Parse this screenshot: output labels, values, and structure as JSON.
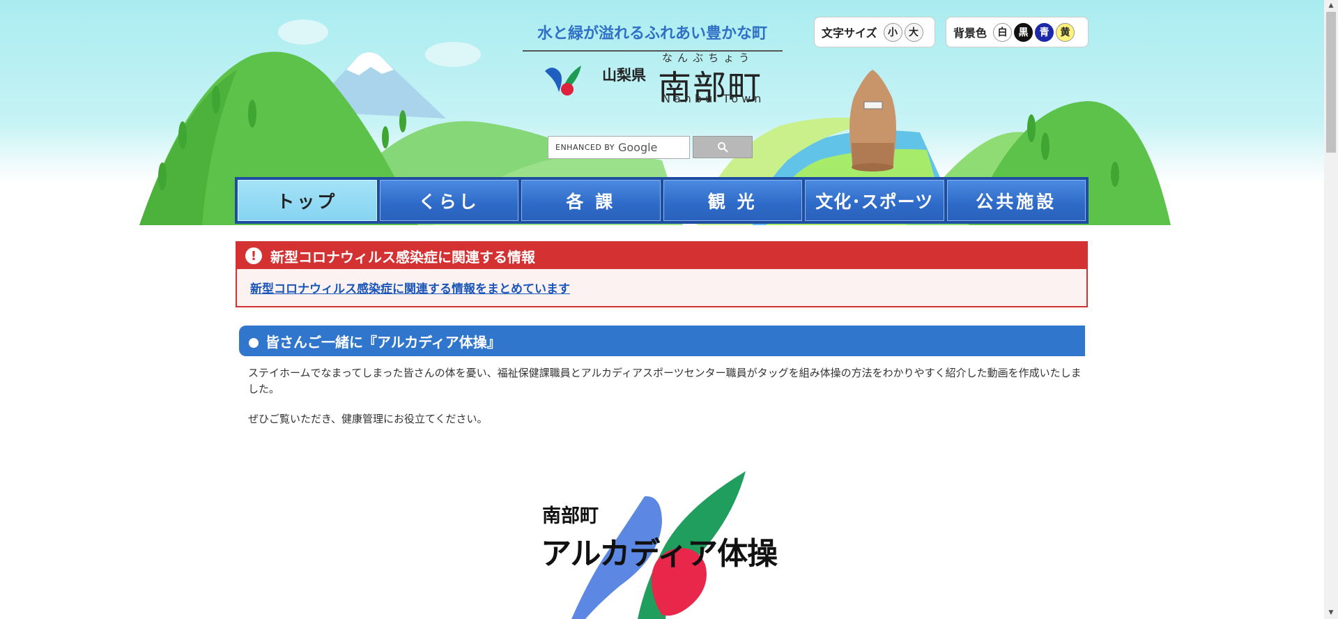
{
  "header": {
    "tagline": "水と緑が溢れるふれあい豊かな町",
    "prefecture": "山梨県",
    "town_kana": "なんぶちょう",
    "town_name": "南部町",
    "town_roman": "Nanbu Town"
  },
  "font_size_control": {
    "label": "文字サイズ",
    "small": "小",
    "large": "大"
  },
  "bg_color_control": {
    "label": "背景色",
    "white": "白",
    "black": "黒",
    "blue": "青",
    "yellow": "黄"
  },
  "search": {
    "placeholder_small": "ENHANCED BY",
    "placeholder_brand": "Google",
    "button_icon": "search-icon"
  },
  "nav": {
    "items": [
      {
        "label": "トップ"
      },
      {
        "label": "くらし"
      },
      {
        "label": "各 課"
      },
      {
        "label": "観 光"
      },
      {
        "label": "文化･スポーツ"
      },
      {
        "label": "公共施設"
      }
    ]
  },
  "notice": {
    "title": "新型コロナウィルス感染症に関連する情報",
    "link": "新型コロナウィルス感染症に関連する情報をまとめています"
  },
  "section": {
    "title": "皆さんご一緒に『アルカディア体操』",
    "para1": "ステイホームでなまってしまった皆さんの体を憂い、福祉保健課職員とアルカディアスポーツセンター職員がタッグを組み体操の方法をわかりやすく紹介した動画を作成いたしました。",
    "para2": "ぜひご覧いただき、健康管理にお役立てください。"
  },
  "promo": {
    "line1": "南部町",
    "line2": "アルカディア体操"
  },
  "colors": {
    "nav_blue": "#2e6ac8",
    "nav_active": "#86d4f2",
    "notice_red": "#d43232",
    "section_blue": "#2f76cc",
    "link": "#1a55b8"
  }
}
